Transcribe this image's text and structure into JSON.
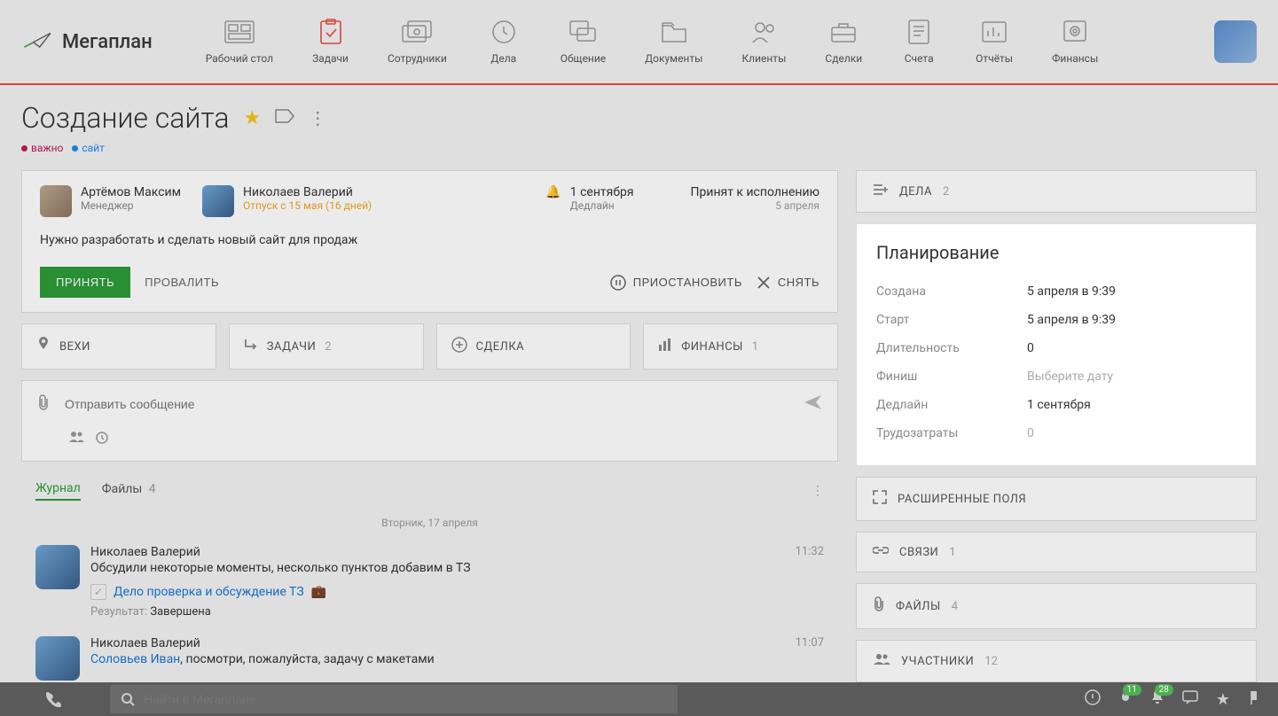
{
  "brand": "Мегаплан",
  "nav": [
    {
      "label": "Рабочий стол"
    },
    {
      "label": "Задачи"
    },
    {
      "label": "Сотрудники"
    },
    {
      "label": "Дела"
    },
    {
      "label": "Общение"
    },
    {
      "label": "Документы"
    },
    {
      "label": "Клиенты"
    },
    {
      "label": "Сделки"
    },
    {
      "label": "Счета"
    },
    {
      "label": "Отчёты"
    },
    {
      "label": "Финансы"
    }
  ],
  "page": {
    "title": "Создание сайта",
    "labels": [
      {
        "text": "важно",
        "kind": "important"
      },
      {
        "text": "сайт",
        "kind": "site"
      }
    ]
  },
  "task": {
    "owner": {
      "name": "Артёмов Максим",
      "role": "Менеджер"
    },
    "assignee": {
      "name": "Николаев Валерий",
      "vacation": "Отпуск с 15 мая (16 дней)"
    },
    "deadline": {
      "date": "1 сентября",
      "label": "Дедлайн"
    },
    "status": {
      "text": "Принят к исполнению",
      "date": "5 апреля"
    },
    "description": "Нужно разработать и сделать новый сайт для продаж",
    "actions": {
      "accept": "ПРИНЯТЬ",
      "fail": "ПРОВАЛИТЬ",
      "pause": "ПРИОСТАНОВИТЬ",
      "remove": "СНЯТЬ"
    }
  },
  "subtabs": {
    "milestones": "ВЕХИ",
    "tasks": {
      "label": "ЗАДАЧИ",
      "count": "2"
    },
    "deal": "СДЕЛКА",
    "finance": {
      "label": "ФИНАНСЫ",
      "count": "1"
    }
  },
  "comment": {
    "placeholder": "Отправить сообщение"
  },
  "journal": {
    "tabs": {
      "journal": "Журнал",
      "files": "Файлы",
      "filesCount": "4"
    },
    "dateSep": "Вторник, 17 апреля",
    "entries": [
      {
        "name": "Николаев Валерий",
        "text": "Обсудили некоторые моменты, несколько пунктов добавим в ТЗ",
        "time": "11:32",
        "linked": "Дело проверка и обсуждение ТЗ",
        "result_label": "Результат:",
        "result_value": "Завершена"
      },
      {
        "name": "Николаев Валерий",
        "mention": "Соловьев Иван",
        "text": ", посмотри, пожалуйста, задачу с макетами",
        "time": "11:07"
      }
    ]
  },
  "right": {
    "deals": {
      "label": "ДЕЛА",
      "count": "2"
    },
    "planning": {
      "title": "Планирование",
      "rows": {
        "created": {
          "label": "Создана",
          "value": "5 апреля в 9:39"
        },
        "start": {
          "label": "Старт",
          "value": "5 апреля в 9:39"
        },
        "duration": {
          "label": "Длительность",
          "value": "0"
        },
        "finish": {
          "label": "Финиш",
          "value": "Выберите дату"
        },
        "deadline": {
          "label": "Дедлайн",
          "value": "1 сентября"
        },
        "effort": {
          "label": "Трудозатраты",
          "value": "0"
        }
      }
    },
    "extFields": "РАСШИРЕННЫЕ ПОЛЯ",
    "links": {
      "label": "СВЯЗИ",
      "count": "1"
    },
    "files": {
      "label": "ФАЙЛЫ",
      "count": "4"
    },
    "participants": {
      "label": "УЧАСТНИКИ",
      "count": "12"
    }
  },
  "bottom": {
    "search": "Найти в Мегаплане",
    "badges": {
      "fire": "11",
      "bell": "28"
    }
  }
}
